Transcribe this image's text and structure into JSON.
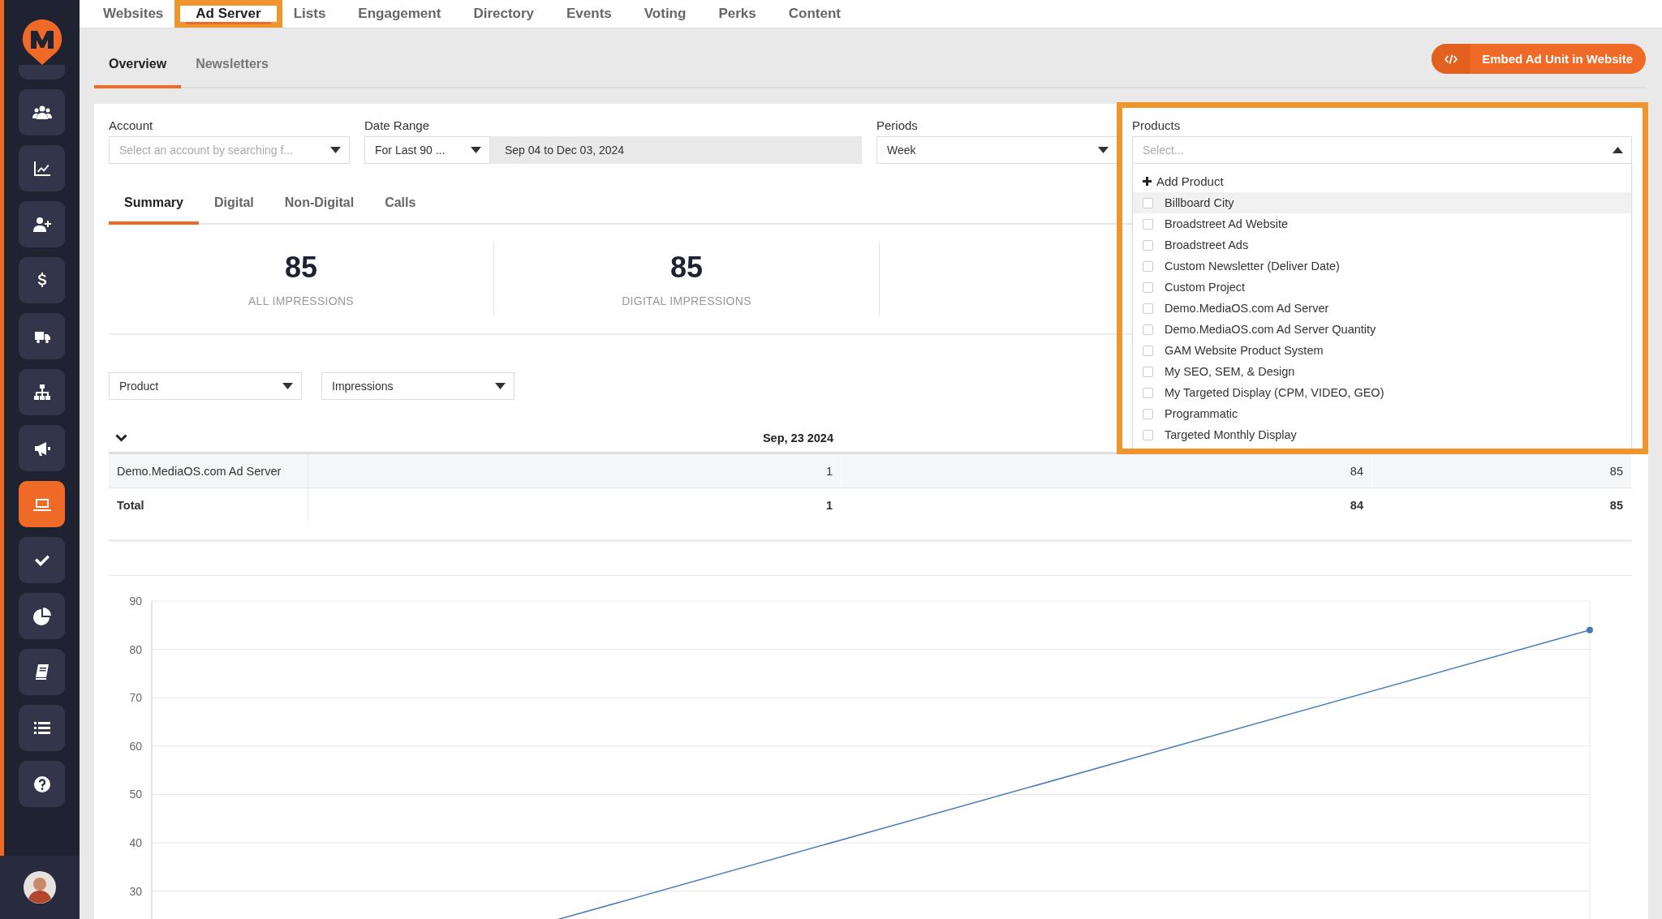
{
  "top_nav": {
    "tabs": [
      {
        "label": "Websites",
        "selected": false
      },
      {
        "label": "Ad Server",
        "selected": true,
        "highlighted": true
      },
      {
        "label": "Lists",
        "selected": false
      },
      {
        "label": "Engagement",
        "selected": false
      },
      {
        "label": "Directory",
        "selected": false
      },
      {
        "label": "Events",
        "selected": false
      },
      {
        "label": "Voting",
        "selected": false
      },
      {
        "label": "Perks",
        "selected": false
      },
      {
        "label": "Content",
        "selected": false
      }
    ]
  },
  "sidebar": {
    "items": [
      {
        "selected": false
      },
      {
        "selected": false
      },
      {
        "selected": false
      },
      {
        "selected": false
      },
      {
        "selected": false
      },
      {
        "selected": false
      },
      {
        "selected": false
      },
      {
        "selected": true
      },
      {
        "selected": false
      },
      {
        "selected": false
      },
      {
        "selected": false
      },
      {
        "selected": false
      },
      {
        "selected": false
      }
    ]
  },
  "sub_tabs": [
    {
      "label": "Overview",
      "selected": true
    },
    {
      "label": "Newsletters",
      "selected": false
    }
  ],
  "embed_button": {
    "label": "Embed Ad Unit in Website"
  },
  "filters": {
    "account": {
      "label": "Account",
      "placeholder": "Select an account by searching f..."
    },
    "date_range": {
      "label": "Date Range",
      "value": "For Last 90 ...",
      "range": "Sep 04 to Dec 03, 2024"
    },
    "periods": {
      "label": "Periods",
      "value": "Week"
    },
    "products": {
      "label": "Products",
      "placeholder": "Select...",
      "expanded": true,
      "highlighted": true,
      "add_label": "Add Product",
      "options": [
        {
          "label": "Billboard City",
          "checked": false,
          "hovered": true
        },
        {
          "label": "Broadstreet Ad Website",
          "checked": false,
          "hovered": false
        },
        {
          "label": "Broadstreet Ads",
          "checked": false,
          "hovered": false
        },
        {
          "label": "Custom Newsletter (Deliver Date)",
          "checked": false,
          "hovered": false
        },
        {
          "label": "Custom Project",
          "checked": false,
          "hovered": false
        },
        {
          "label": "Demo.MediaOS.com Ad Server",
          "checked": false,
          "hovered": false
        },
        {
          "label": "Demo.MediaOS.com Ad Server Quantity",
          "checked": false,
          "hovered": false
        },
        {
          "label": "GAM Website Product System",
          "checked": false,
          "hovered": false
        },
        {
          "label": "My SEO, SEM, & Design",
          "checked": false,
          "hovered": false
        },
        {
          "label": "My Targeted Display (CPM, VIDEO, GEO)",
          "checked": false,
          "hovered": false
        },
        {
          "label": "Programmatic",
          "checked": false,
          "hovered": false
        },
        {
          "label": "Targeted Monthly Display",
          "checked": false,
          "hovered": false
        }
      ]
    }
  },
  "report_tabs": [
    {
      "label": "Summary",
      "selected": true
    },
    {
      "label": "Digital",
      "selected": false
    },
    {
      "label": "Non-Digital",
      "selected": false
    },
    {
      "label": "Calls",
      "selected": false
    }
  ],
  "stats": [
    {
      "value": "85",
      "label": "ALL IMPRESSIONS"
    },
    {
      "value": "85",
      "label": "DIGITAL IMPRESSIONS"
    }
  ],
  "grouping": {
    "dimension": "Product",
    "metric": "Impressions"
  },
  "table": {
    "columns": [
      "",
      "Sep, 23 2024"
    ],
    "rows": [
      {
        "kind": "data",
        "cells": [
          "Demo.MediaOS.com Ad Server",
          "1",
          "84",
          "85"
        ]
      },
      {
        "kind": "total",
        "cells": [
          "Total",
          "1",
          "84",
          "85"
        ]
      }
    ]
  },
  "chart": {
    "y_ticks": [
      "90",
      "80",
      "70",
      "60",
      "50",
      "40",
      "30"
    ]
  }
}
